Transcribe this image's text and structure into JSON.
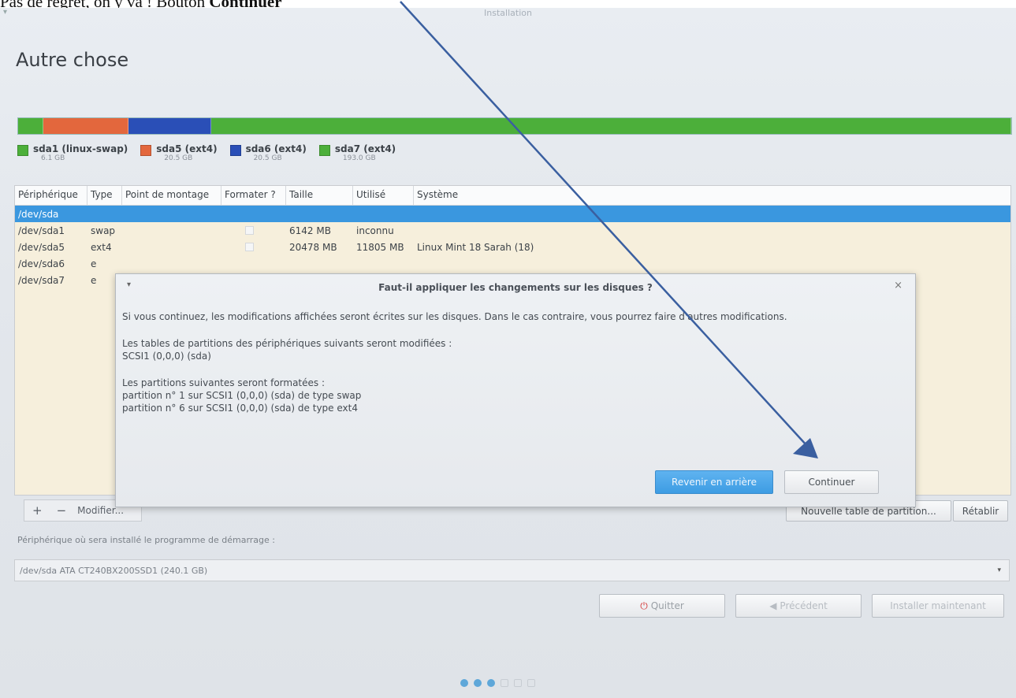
{
  "caption": {
    "prefix": "Pas de regret, on y va ! Bouton ",
    "bold": "Continuer"
  },
  "window": {
    "title": "Installation",
    "menu_glyph": "▾"
  },
  "page_title": "Autre chose",
  "partition_bar": [
    {
      "color": "#4caf3a",
      "fraction": 0.025
    },
    {
      "color": "#e3673d",
      "fraction": 0.085
    },
    {
      "color": "#2a4fb7",
      "fraction": 0.083
    },
    {
      "color": "#4caf3a",
      "fraction": 0.807
    }
  ],
  "legend": [
    {
      "label": "sda1 (linux-swap)",
      "size": "6.1 GB",
      "color": "#4caf3a"
    },
    {
      "label": "sda5 (ext4)",
      "size": "20.5 GB",
      "color": "#e3673d"
    },
    {
      "label": "sda6 (ext4)",
      "size": "20.5 GB",
      "color": "#2a4fb7"
    },
    {
      "label": "sda7 (ext4)",
      "size": "193.0 GB",
      "color": "#4caf3a"
    }
  ],
  "table": {
    "headers": [
      "Périphérique",
      "Type",
      "Point de montage",
      "Formater ?",
      "Taille",
      "Utilisé",
      "Système"
    ],
    "rows": [
      {
        "device": "/dev/sda",
        "type": "",
        "mount": "",
        "size": "",
        "used": "",
        "system": "",
        "selected": true
      },
      {
        "device": "/dev/sda1",
        "type": "swap",
        "mount": "",
        "size": "6142 MB",
        "used": "inconnu",
        "system": ""
      },
      {
        "device": "/dev/sda5",
        "type": "ext4",
        "mount": "",
        "size": "20478 MB",
        "used": "11805 MB",
        "system": "Linux Mint 18 Sarah (18)"
      },
      {
        "device": "/dev/sda6",
        "type": "e",
        "mount": "",
        "size": "",
        "used": "",
        "system": ""
      },
      {
        "device": "/dev/sda7",
        "type": "e",
        "mount": "",
        "size": "",
        "used": "",
        "system": ""
      }
    ]
  },
  "dialog": {
    "title": "Faut-il appliquer les changements sur les disques ?",
    "menu_glyph": "▾",
    "close_glyph": "×",
    "line1": "Si vous continuez, les modifications affichées seront écrites sur les disques. Dans le cas contraire, vous pourrez faire d'autres modifications.",
    "line2": "Les tables de partitions des périphériques suivants seront modifiées :",
    "line3": " SCSI1 (0,0,0) (sda)",
    "line4": "Les partitions suivantes seront formatées :",
    "line5": " partition n° 1 sur SCSI1 (0,0,0) (sda) de type swap",
    "line6": " partition n° 6 sur SCSI1 (0,0,0) (sda) de type ext4",
    "back_button": "Revenir en arrière",
    "continue_button": "Continuer"
  },
  "toolbar": {
    "add": "+",
    "remove": "−",
    "modify": "Modifier...",
    "new_table": "Nouvelle table de partition...",
    "restore": "Rétablir"
  },
  "bootloader": {
    "label": "Périphérique où sera installé le programme de démarrage :",
    "value": "/dev/sda   ATA CT240BX200SSD1 (240.1 GB)",
    "arrow_glyph": "▾"
  },
  "footer": {
    "quit": "Quitter",
    "quit_glyph": "⏻",
    "previous": "Précédent",
    "previous_glyph": "◀",
    "install": "Installer maintenant"
  },
  "progress": {
    "current": 3,
    "total": 6
  },
  "colors": {
    "accent": "#3a97df",
    "arrow": "#3a5fa0"
  }
}
